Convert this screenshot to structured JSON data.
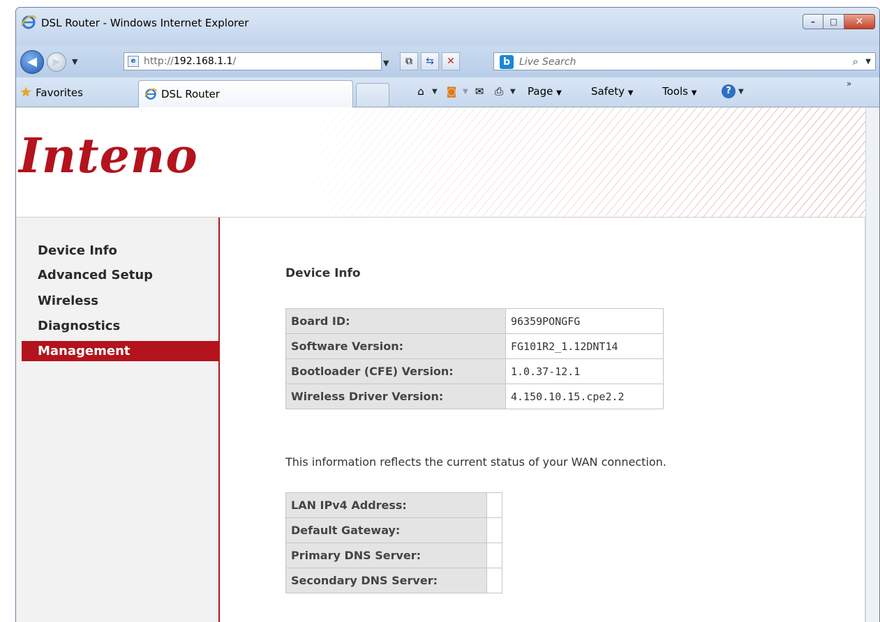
{
  "window": {
    "title": "DSL Router - Windows Internet Explorer",
    "controls": {
      "minimize": "–",
      "restore": "□",
      "close": "✕"
    }
  },
  "navbar": {
    "address": {
      "protocol": "http://",
      "host": "192.168.1.1",
      "path": "/"
    },
    "search_placeholder": "Live Search",
    "search_provider_glyph": "b"
  },
  "tabbar": {
    "favorites_label": "Favorites",
    "active_tab_label": "DSL Router",
    "commands": {
      "page": "Page",
      "safety": "Safety",
      "tools": "Tools"
    }
  },
  "page": {
    "logo_text": "Inteno",
    "sidebar": {
      "items": [
        {
          "label": "Device Info",
          "active": false
        },
        {
          "label": "Advanced Setup",
          "active": false
        },
        {
          "label": "Wireless",
          "active": false
        },
        {
          "label": "Diagnostics",
          "active": false
        },
        {
          "label": "Management",
          "active": true
        }
      ]
    },
    "main": {
      "title": "Device Info",
      "device_table": [
        {
          "key": "Board ID:",
          "value": "96359PONGFG"
        },
        {
          "key": "Software Version:",
          "value": "FG101R2_1.12DNT14"
        },
        {
          "key": "Bootloader (CFE) Version:",
          "value": "1.0.37-12.1"
        },
        {
          "key": "Wireless Driver Version:",
          "value": "4.150.10.15.cpe2.2"
        }
      ],
      "wan_note": "This information reflects the current status of your WAN connection.",
      "wan_table": [
        {
          "key": "LAN IPv4 Address:",
          "value": ""
        },
        {
          "key": "Default Gateway:",
          "value": ""
        },
        {
          "key": "Primary DNS Server:",
          "value": ""
        },
        {
          "key": "Secondary DNS Server:",
          "value": ""
        }
      ]
    }
  },
  "colors": {
    "brand_red": "#b3131d",
    "sidebar_bg": "#f2f2f2",
    "table_key_bg": "#e4e4e4"
  }
}
